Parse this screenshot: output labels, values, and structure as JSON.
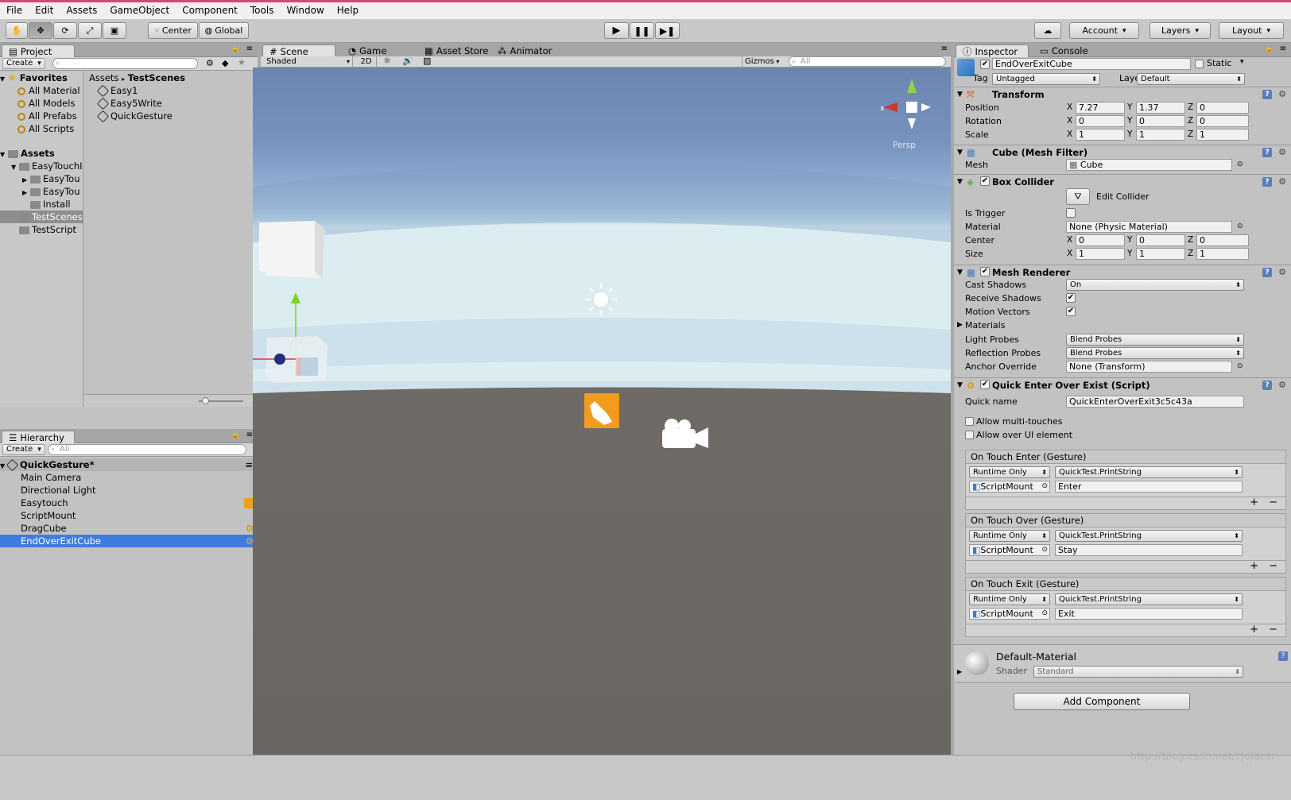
{
  "menu": [
    "File",
    "Edit",
    "Assets",
    "GameObject",
    "Component",
    "Tools",
    "Window",
    "Help"
  ],
  "toolbar": {
    "pivot": "Center",
    "space": "Global",
    "account": "Account",
    "layers": "Layers",
    "layout": "Layout"
  },
  "project": {
    "tab": "Project",
    "create": "Create",
    "favorites_label": "Favorites",
    "favorites": [
      "All Material",
      "All Models",
      "All Prefabs",
      "All Scripts"
    ],
    "assets_label": "Assets",
    "assets": [
      {
        "name": "EasyTouchI",
        "indent": 1,
        "fold": "open"
      },
      {
        "name": "EasyTou",
        "indent": 2,
        "fold": "closed"
      },
      {
        "name": "EasyTou",
        "indent": 2,
        "fold": "closed"
      },
      {
        "name": "Install",
        "indent": 2,
        "fold": ""
      },
      {
        "name": "TestScenes",
        "indent": 1,
        "fold": ""
      },
      {
        "name": "TestScript",
        "indent": 1,
        "fold": ""
      }
    ],
    "breadcrumb": [
      "Assets",
      "TestScenes"
    ],
    "files": [
      "Easy1",
      "Easy5Write",
      "QuickGesture"
    ]
  },
  "hierarchy": {
    "tab": "Hierarchy",
    "create": "Create",
    "search_placeholder": "All",
    "scene": "QuickGesture*",
    "items": [
      "Main Camera",
      "Directional Light",
      "Easytouch",
      "ScriptMount",
      "DragCube",
      "EndOverExitCube"
    ]
  },
  "scene_view": {
    "tabs": [
      "Scene",
      "Game",
      "Asset Store",
      "Animator"
    ],
    "shading": "Shaded",
    "mode_2d": "2D",
    "gizmos": "Gizmos",
    "search_placeholder": "All",
    "persp": "Persp",
    "axis_x": "x"
  },
  "inspector": {
    "tabs": [
      "Inspector",
      "Console"
    ],
    "object_name": "EndOverExitCube",
    "static_label": "Static",
    "tag_label": "Tag",
    "tag": "Untagged",
    "layer_label": "Layer",
    "layer": "Default",
    "transform": {
      "title": "Transform",
      "rows": [
        {
          "label": "Position",
          "x": "7.27",
          "y": "1.37",
          "z": "0"
        },
        {
          "label": "Rotation",
          "x": "0",
          "y": "0",
          "z": "0"
        },
        {
          "label": "Scale",
          "x": "1",
          "y": "1",
          "z": "1"
        }
      ]
    },
    "mesh_filter": {
      "title": "Cube (Mesh Filter)",
      "mesh_label": "Mesh",
      "mesh": "Cube"
    },
    "box_collider": {
      "title": "Box Collider",
      "edit": "Edit Collider",
      "is_trigger": "Is Trigger",
      "material_label": "Material",
      "material": "None (Physic Material)",
      "center_label": "Center",
      "center": {
        "x": "0",
        "y": "0",
        "z": "0"
      },
      "size_label": "Size",
      "size": {
        "x": "1",
        "y": "1",
        "z": "1"
      }
    },
    "mesh_renderer": {
      "title": "Mesh Renderer",
      "cast_shadows_label": "Cast Shadows",
      "cast_shadows": "On",
      "receive_shadows": "Receive Shadows",
      "motion_vectors": "Motion Vectors",
      "materials": "Materials",
      "light_probes_label": "Light Probes",
      "light_probes": "Blend Probes",
      "reflection_probes_label": "Reflection Probes",
      "reflection_probes": "Blend Probes",
      "anchor_label": "Anchor Override",
      "anchor": "None (Transform)"
    },
    "script": {
      "title": "Quick Enter Over Exist (Script)",
      "quick_name_label": "Quick name",
      "quick_name": "QuickEnterOverExit3c5c43a",
      "allow_multi": "Allow multi-touches",
      "allow_ui": "Allow over UI element",
      "events": [
        {
          "title": "On Touch Enter (Gesture)",
          "runtime": "Runtime Only",
          "func": "QuickTest.PrintString",
          "target": "ScriptMount",
          "arg": "Enter"
        },
        {
          "title": "On Touch Over (Gesture)",
          "runtime": "Runtime Only",
          "func": "QuickTest.PrintString",
          "target": "ScriptMount",
          "arg": "Stay"
        },
        {
          "title": "On Touch Exit (Gesture)",
          "runtime": "Runtime Only",
          "func": "QuickTest.PrintString",
          "target": "ScriptMount",
          "arg": "Exit"
        }
      ]
    },
    "material": {
      "name": "Default-Material",
      "shader_label": "Shader",
      "shader": "Standard"
    },
    "add_component": "Add Component"
  },
  "watermark": "http://blog.csdn.net/cjdjacsr"
}
